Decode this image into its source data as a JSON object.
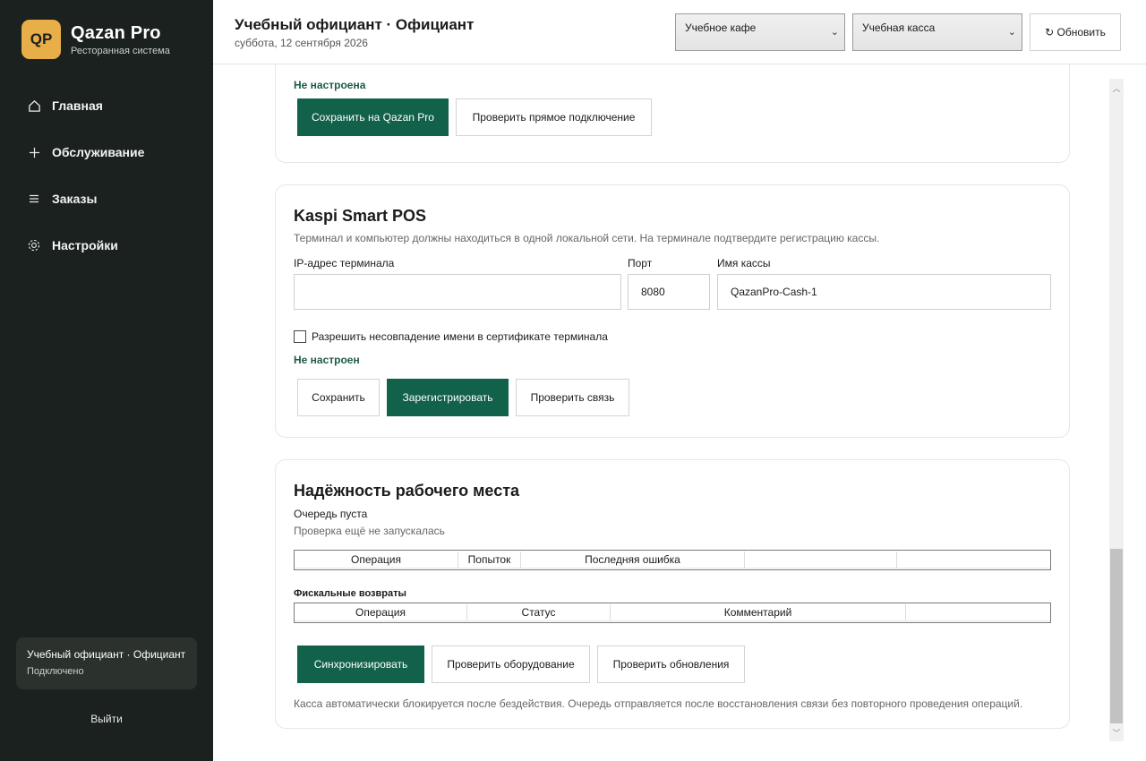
{
  "sidebar": {
    "logo_text": "QP",
    "brand_name": "Qazan Pro",
    "brand_subtitle": "Ресторанная система",
    "nav": [
      {
        "label": "Главная",
        "icon": "home-icon"
      },
      {
        "label": "Обслуживание",
        "icon": "plus-icon"
      },
      {
        "label": "Заказы",
        "icon": "list-icon"
      },
      {
        "label": "Настройки",
        "icon": "gear-icon"
      }
    ],
    "user": {
      "name": "Учебный официант · Официант",
      "status": "Подключено"
    },
    "logout_label": "Выйти"
  },
  "header": {
    "title": "Учебный официант · Официант",
    "date": "суббота, 12 сентября 2026",
    "cafe_select": "Учебное кафе",
    "register_select": "Учебная касса",
    "refresh_label": "↻ Обновить"
  },
  "qazan_card": {
    "status": "Не настроена",
    "save_label": "Сохранить на Qazan Pro",
    "check_label": "Проверить прямое подключение"
  },
  "kaspi": {
    "title": "Kaspi Smart POS",
    "hint": "Терминал и компьютер должны находиться в одной локальной сети. На терминале подтвердите регистрацию кассы.",
    "ip_label": "IP-адрес терминала",
    "ip_value": "",
    "port_label": "Порт",
    "port_value": "8080",
    "cash_label": "Имя кассы",
    "cash_value": "QazanPro-Cash-1",
    "checkbox_label": "Разрешить несовпадение имени в сертификате терминала",
    "checkbox_checked": false,
    "status": "Не настроен",
    "save_label": "Сохранить",
    "register_label": "Зарегистрировать",
    "check_label": "Проверить связь"
  },
  "reliability": {
    "title": "Надёжность рабочего места",
    "queue_status": "Очередь пуста",
    "check_status": "Проверка ещё не запускалась",
    "queue_columns": [
      "Операция",
      "Попыток",
      "Последняя ошибка",
      "",
      ""
    ],
    "refunds_label": "Фискальные возвраты",
    "refund_columns": [
      "Операция",
      "Статус",
      "Комментарий",
      ""
    ],
    "sync_label": "Синхронизировать",
    "check_hardware_label": "Проверить оборудование",
    "check_updates_label": "Проверить обновления",
    "footer_note": "Касса автоматически блокируется после бездействия. Очередь отправляется после восстановления связи без повторного проведения операций."
  },
  "colors": {
    "sidebar_bg": "#1b211e",
    "accent": "#12614a",
    "logo_bg": "#e8ae48",
    "status_text": "#1d5c45"
  }
}
